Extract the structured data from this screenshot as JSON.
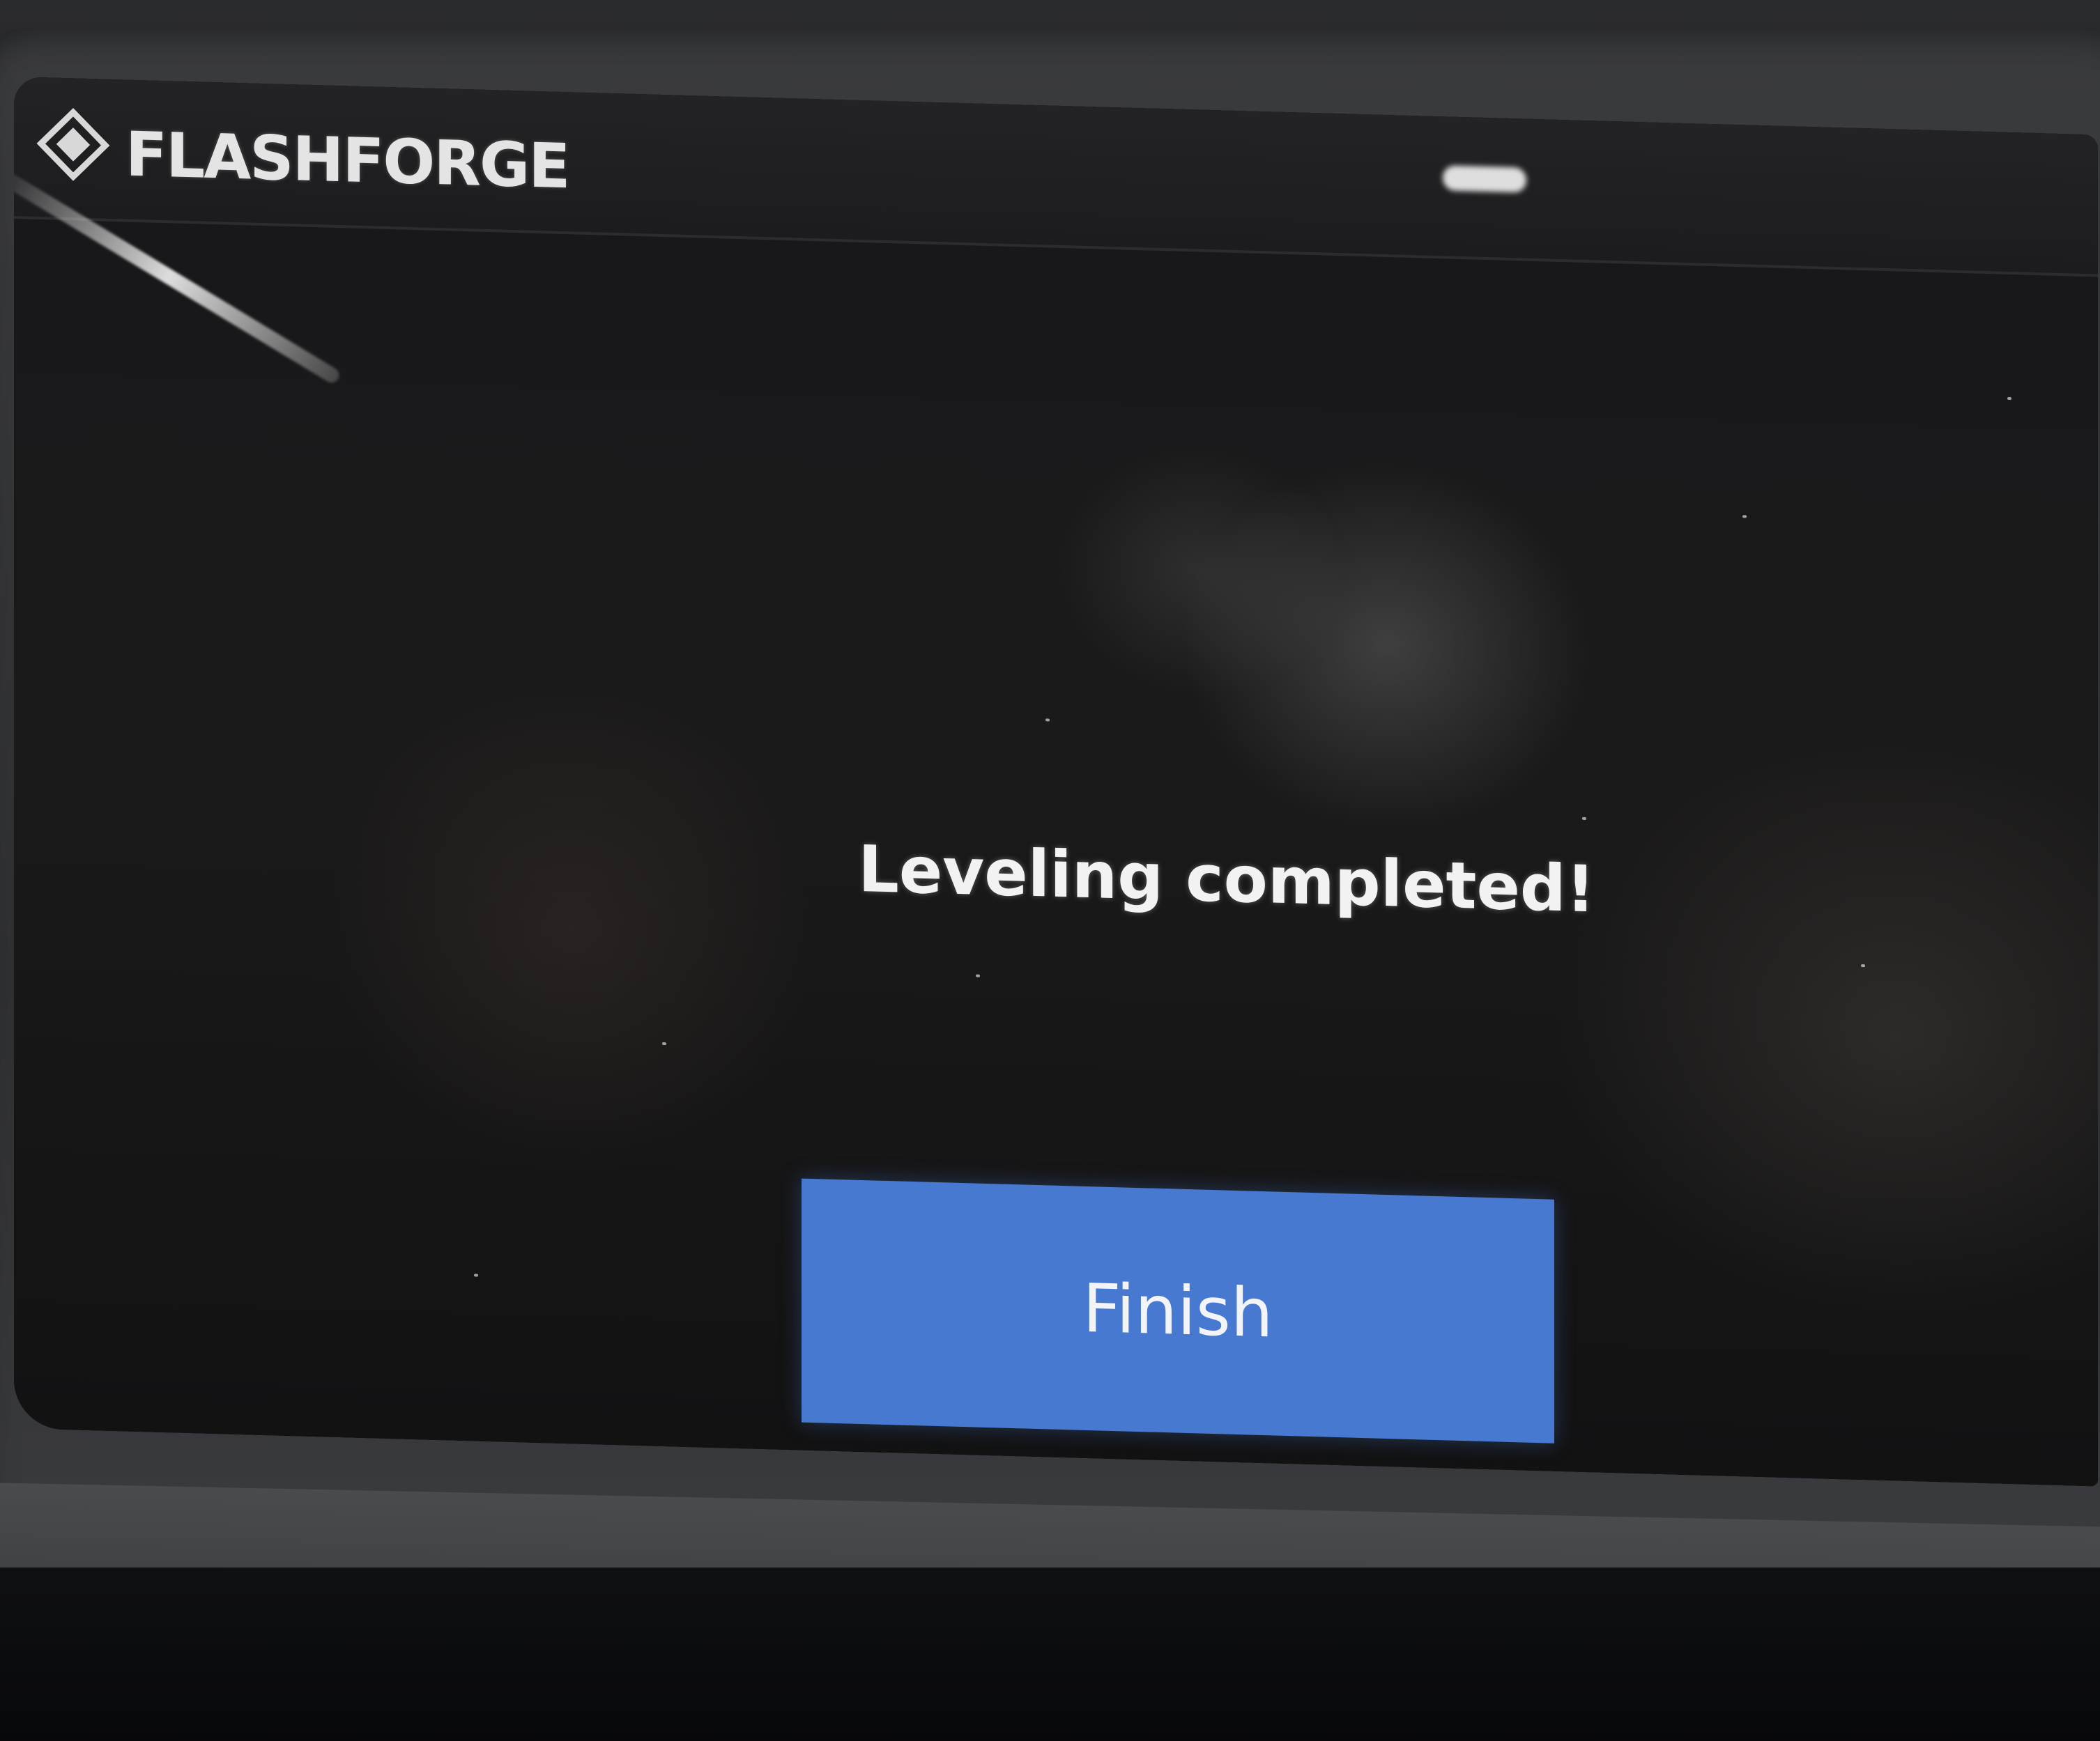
{
  "header": {
    "brand_name": "FLASHFORGE",
    "logo_icon": "flashforge-logo-icon"
  },
  "dialog": {
    "message": "Leveling completed!",
    "finish_label": "Finish"
  },
  "colors": {
    "button": "#4679cf",
    "screen_background": "#17171a",
    "text": "#f2f2f2"
  }
}
